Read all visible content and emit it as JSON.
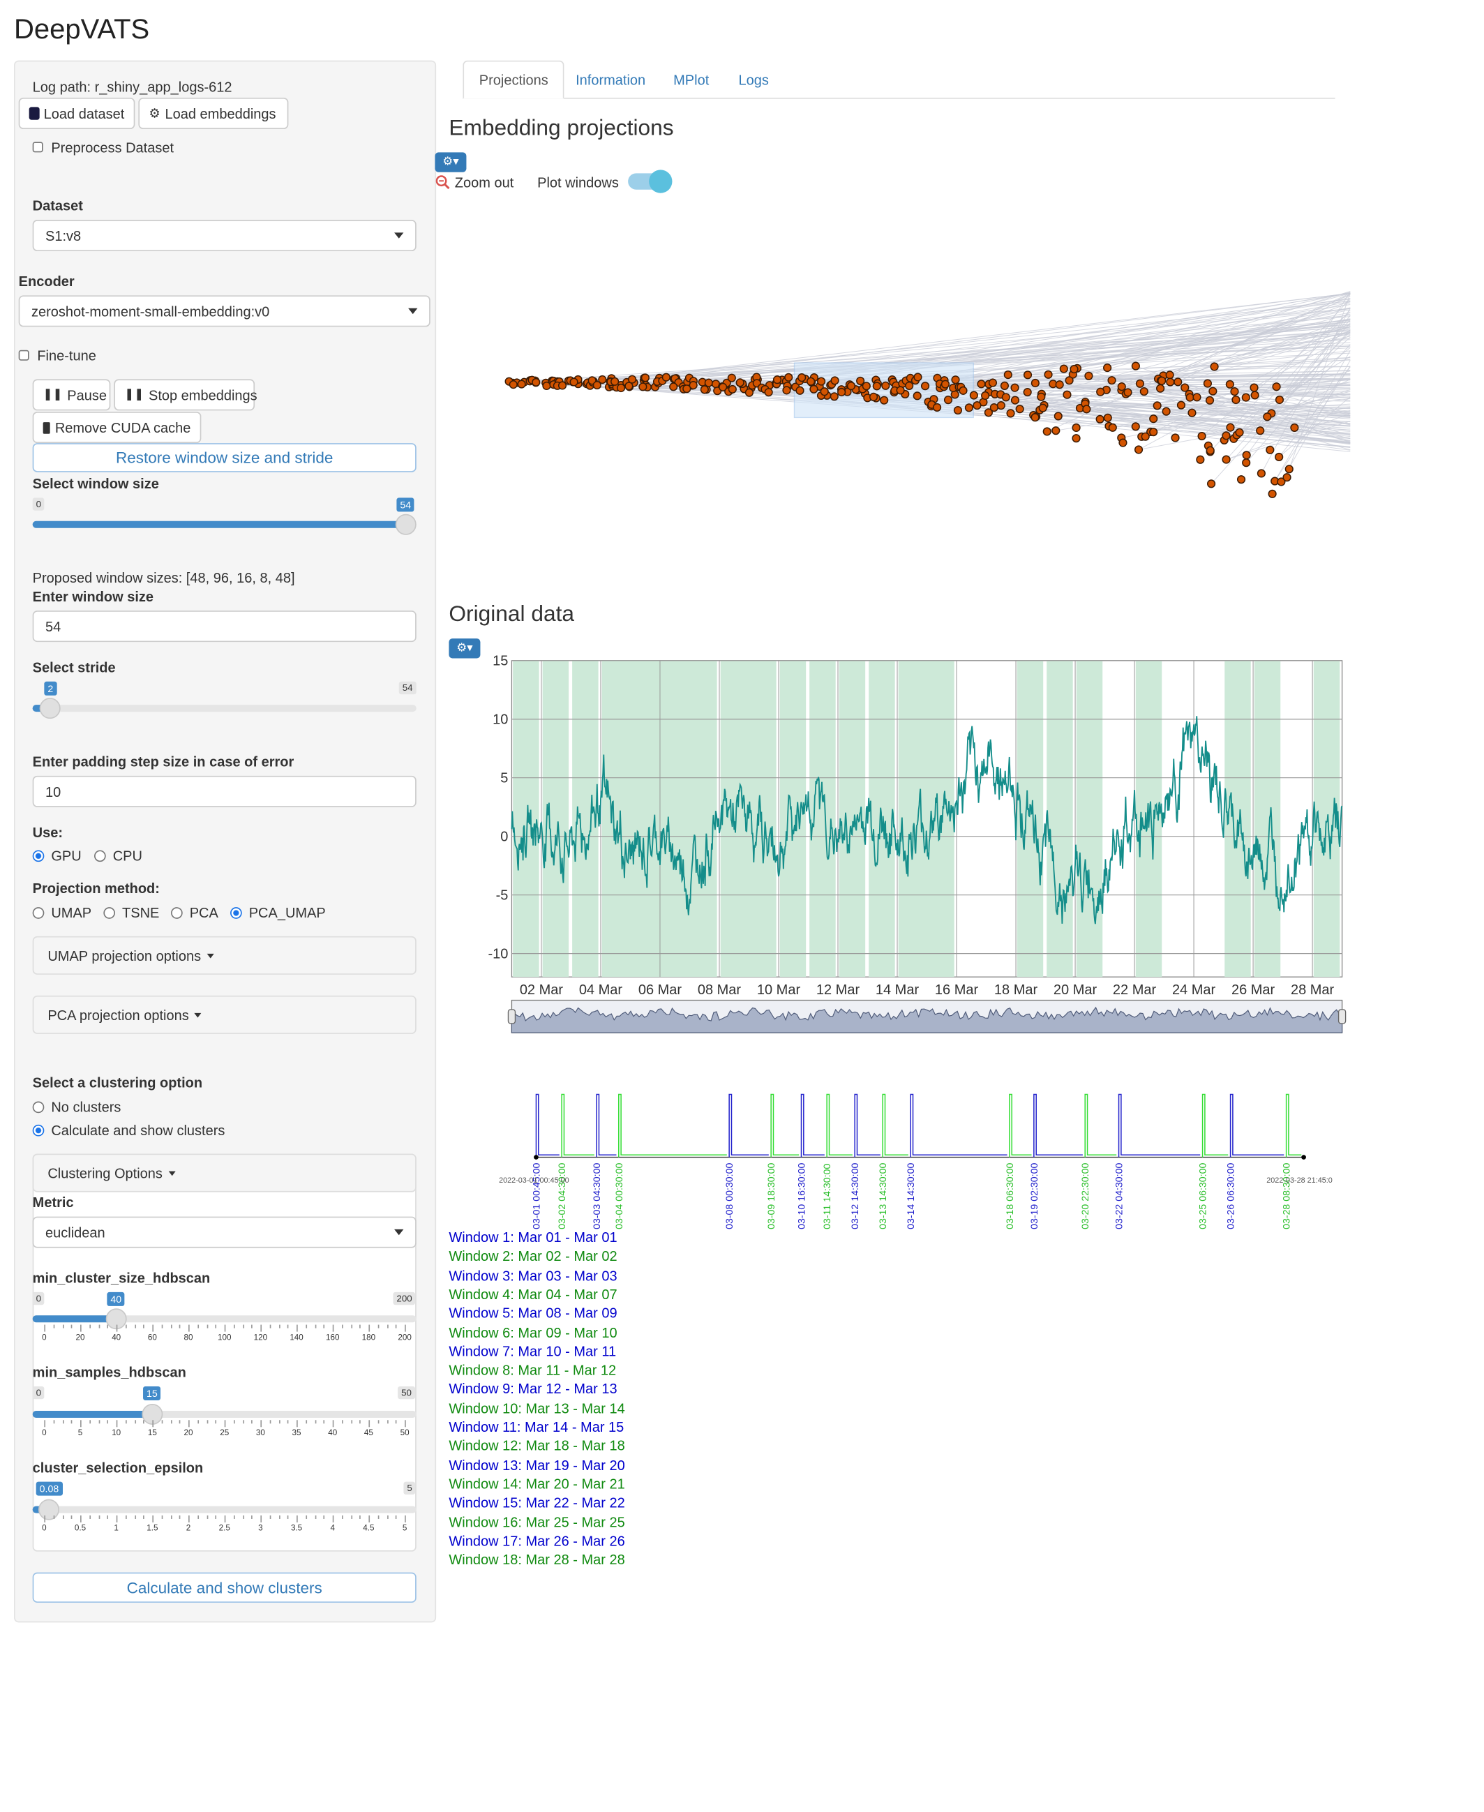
{
  "app": {
    "title": "DeepVATS"
  },
  "sidebar": {
    "log_path": "Log path: r_shiny_app_logs-612",
    "load_dataset": "Load dataset",
    "load_embeddings": "Load embeddings",
    "preprocess": "Preprocess Dataset",
    "dataset_label": "Dataset",
    "dataset_value": "S1:v8",
    "encoder_label": "Encoder",
    "encoder_value": "zeroshot-moment-small-embedding:v0",
    "fine_tune": "Fine-tune",
    "pause": "Pause",
    "stop_embeddings": "Stop embeddings",
    "remove_cuda": "Remove CUDA cache",
    "restore_window": "Restore window size and stride",
    "window_size_label": "Select window size",
    "window_size": {
      "min": "0",
      "max": "54",
      "value": "54",
      "fraction": 1.0
    },
    "proposed_window_sizes": "Proposed window sizes: [48, 96, 16, 8, 48]",
    "enter_window_label": "Enter window size",
    "enter_window_value": "54",
    "stride_label": "Select stride",
    "stride": {
      "min": "1",
      "max": "54",
      "value": "2",
      "fraction": 0.02
    },
    "padding_label": "Enter padding step size in case of error",
    "padding_value": "10",
    "use_label": "Use:",
    "use_options": [
      "GPU",
      "CPU"
    ],
    "use_selected": "GPU",
    "projection_label": "Projection method:",
    "projection_options": [
      "UMAP",
      "TSNE",
      "PCA",
      "PCA_UMAP"
    ],
    "projection_selected": "PCA_UMAP",
    "umap_options": "UMAP projection options",
    "pca_options": "PCA projection options",
    "clustering_label": "Select a clustering option",
    "clustering_options": [
      "No clusters",
      "Calculate and show clusters"
    ],
    "clustering_selected": "Calculate and show clusters",
    "clustering_panel": "Clustering Options",
    "metric_label": "Metric",
    "metric_value": "euclidean",
    "min_cluster": {
      "label": "min_cluster_size_hdbscan",
      "min": "0",
      "max": "200",
      "value": "40",
      "fraction": 0.2,
      "ticks": [
        "0",
        "20",
        "40",
        "60",
        "80",
        "100",
        "120",
        "140",
        "160",
        "180",
        "200"
      ]
    },
    "min_samples": {
      "label": "min_samples_hdbscan",
      "min": "0",
      "max": "50",
      "value": "15",
      "fraction": 0.3,
      "ticks": [
        "0",
        "5",
        "10",
        "15",
        "20",
        "25",
        "30",
        "35",
        "40",
        "45",
        "50"
      ]
    },
    "epsilon": {
      "label": "cluster_selection_epsilon",
      "min": "0",
      "max": "5",
      "value": "0.08",
      "fraction": 0.016,
      "ticks": [
        "0",
        "0.5",
        "1",
        "1.5",
        "2",
        "2.5",
        "3",
        "3.5",
        "4",
        "4.5",
        "5"
      ]
    },
    "calc_button": "Calculate and show clusters"
  },
  "tabs": [
    "Projections",
    "Information",
    "MPlot",
    "Logs"
  ],
  "active_tab": "Projections",
  "main": {
    "embedding_title": "Embedding projections",
    "zoom_out": "Zoom out",
    "plot_windows": "Plot windows",
    "plot_windows_on": true,
    "original_title": "Original data",
    "timeline_start": "2022-03-01 00:45:00",
    "timeline_end": "2022-03-28 21:45:0"
  },
  "colors": {
    "accent": "#337ab7",
    "series": "#138d8a",
    "points": "#d35400",
    "window_band": "#cde9d8",
    "blue": "#0000cc",
    "green": "#108a10",
    "timeline_green": "#33dd33"
  },
  "chart_data": {
    "type": "line",
    "title": "Original data",
    "x_tick_labels": [
      "02 Mar",
      "04 Mar",
      "06 Mar",
      "08 Mar",
      "10 Mar",
      "12 Mar",
      "14 Mar",
      "16 Mar",
      "18 Mar",
      "20 Mar",
      "22 Mar",
      "24 Mar",
      "26 Mar",
      "28 Mar"
    ],
    "xlim": [
      "2022-03-01",
      "2022-03-29"
    ],
    "ylim": [
      -12,
      15
    ],
    "y_ticks": [
      15,
      10,
      5,
      0,
      -5,
      -10
    ],
    "grid": true,
    "series": [
      {
        "x": [
          "2022-03-01",
          "2022-03-02",
          "2022-03-03",
          "2022-03-04",
          "2022-03-05",
          "2022-03-06",
          "2022-03-07",
          "2022-03-08",
          "2022-03-09",
          "2022-03-10",
          "2022-03-11",
          "2022-03-12",
          "2022-03-13",
          "2022-03-14",
          "2022-03-15",
          "2022-03-16",
          "2022-03-17",
          "2022-03-18",
          "2022-03-19",
          "2022-03-20",
          "2022-03-21",
          "2022-03-22",
          "2022-03-23",
          "2022-03-24",
          "2022-03-25",
          "2022-03-26",
          "2022-03-27",
          "2022-03-28",
          "2022-03-29"
        ],
        "values": [
          2,
          0.5,
          -1,
          3,
          -2,
          0,
          -3,
          2,
          1,
          -1,
          4,
          -0.5,
          2,
          0,
          1,
          3,
          7,
          4,
          -2,
          -5,
          -2,
          1,
          3,
          8,
          2,
          -2,
          -1,
          0,
          1
        ]
      }
    ],
    "highlighted_windows": [
      [
        "2022-03-01",
        "2022-03-02"
      ],
      [
        "2022-03-02",
        "2022-03-03"
      ],
      [
        "2022-03-03",
        "2022-03-04"
      ],
      [
        "2022-03-04",
        "2022-03-08"
      ],
      [
        "2022-03-08",
        "2022-03-10"
      ],
      [
        "2022-03-10",
        "2022-03-11"
      ],
      [
        "2022-03-11",
        "2022-03-12"
      ],
      [
        "2022-03-12",
        "2022-03-13"
      ],
      [
        "2022-03-13",
        "2022-03-14"
      ],
      [
        "2022-03-14",
        "2022-03-16"
      ],
      [
        "2022-03-18",
        "2022-03-19"
      ],
      [
        "2022-03-19",
        "2022-03-20"
      ],
      [
        "2022-03-20",
        "2022-03-21"
      ],
      [
        "2022-03-22",
        "2022-03-23"
      ],
      [
        "2022-03-25",
        "2022-03-26"
      ],
      [
        "2022-03-26",
        "2022-03-27"
      ],
      [
        "2022-03-28",
        "2022-03-29"
      ]
    ]
  },
  "timeline": {
    "markers": [
      {
        "label": "03-01 00:45:00",
        "color": "blue"
      },
      {
        "label": "03-02 04:30:00",
        "color": "green"
      },
      {
        "label": "03-03 04:30:00",
        "color": "blue"
      },
      {
        "label": "03-04 00:30:00",
        "color": "green"
      },
      {
        "label": "03-08 00:30:00",
        "color": "blue"
      },
      {
        "label": "03-09 18:30:00",
        "color": "green"
      },
      {
        "label": "03-10 16:30:00",
        "color": "blue"
      },
      {
        "label": "03-11 14:30:00",
        "color": "green"
      },
      {
        "label": "03-12 14:30:00",
        "color": "blue"
      },
      {
        "label": "03-13 14:30:00",
        "color": "green"
      },
      {
        "label": "03-14 14:30:00",
        "color": "blue"
      },
      {
        "label": "03-18 06:30:00",
        "color": "green"
      },
      {
        "label": "03-19 02:30:00",
        "color": "blue"
      },
      {
        "label": "03-20 22:30:00",
        "color": "green"
      },
      {
        "label": "03-22 04:30:00",
        "color": "blue"
      },
      {
        "label": "03-25 06:30:00",
        "color": "green"
      },
      {
        "label": "03-26 06:30:00",
        "color": "blue"
      },
      {
        "label": "03-28 08:30:00",
        "color": "green"
      }
    ]
  },
  "windows": [
    {
      "label": "Window 1: Mar 01 - Mar 01",
      "color": "blue"
    },
    {
      "label": "Window 2: Mar 02 - Mar 02",
      "color": "green"
    },
    {
      "label": "Window 3: Mar 03 - Mar 03",
      "color": "blue"
    },
    {
      "label": "Window 4: Mar 04 - Mar 07",
      "color": "green"
    },
    {
      "label": "Window 5: Mar 08 - Mar 09",
      "color": "blue"
    },
    {
      "label": "Window 6: Mar 09 - Mar 10",
      "color": "green"
    },
    {
      "label": "Window 7: Mar 10 - Mar 11",
      "color": "blue"
    },
    {
      "label": "Window 8: Mar 11 - Mar 12",
      "color": "green"
    },
    {
      "label": "Window 9: Mar 12 - Mar 13",
      "color": "blue"
    },
    {
      "label": "Window 10: Mar 13 - Mar 14",
      "color": "green"
    },
    {
      "label": "Window 11: Mar 14 - Mar 15",
      "color": "blue"
    },
    {
      "label": "Window 12: Mar 18 - Mar 18",
      "color": "green"
    },
    {
      "label": "Window 13: Mar 19 - Mar 20",
      "color": "blue"
    },
    {
      "label": "Window 14: Mar 20 - Mar 21",
      "color": "green"
    },
    {
      "label": "Window 15: Mar 22 - Mar 22",
      "color": "blue"
    },
    {
      "label": "Window 16: Mar 25 - Mar 25",
      "color": "green"
    },
    {
      "label": "Window 17: Mar 26 - Mar 26",
      "color": "blue"
    },
    {
      "label": "Window 18: Mar 28 - Mar 28",
      "color": "green"
    }
  ]
}
